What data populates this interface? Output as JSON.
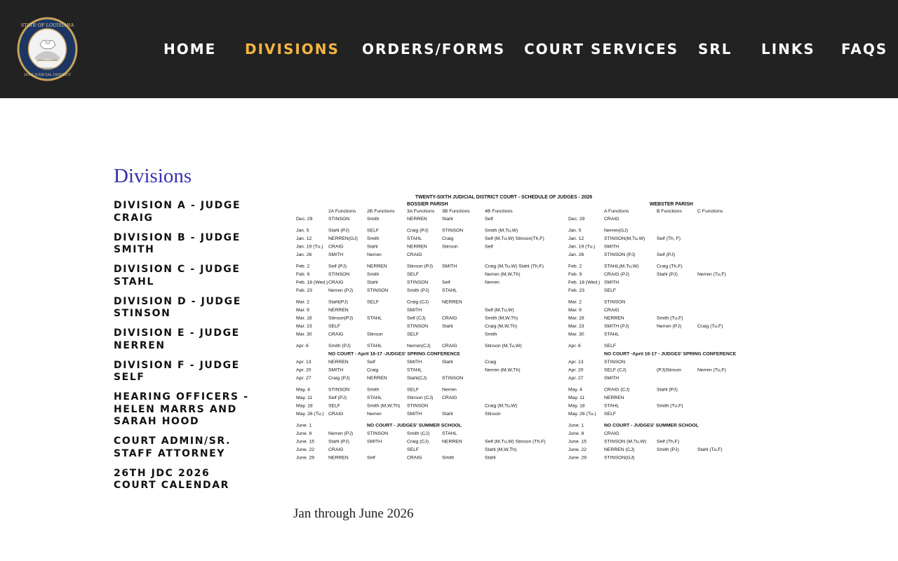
{
  "nav": {
    "items": [
      {
        "label": "HOME"
      },
      {
        "label": "DIVISIONS"
      },
      {
        "label": "ORDERS/FORMS"
      },
      {
        "label": "COURT SERVICES"
      },
      {
        "label": "SRL"
      },
      {
        "label": "LINKS"
      },
      {
        "label": "FAQS"
      }
    ],
    "active_index": 1,
    "active_color": "#f3b543"
  },
  "seal": {
    "icon": "state-seal-icon",
    "text": "STATE OF LOUISIANA · UNION · JUSTICE · CONFIDENCE · 26TH JUDICIAL DISTRICT COURT"
  },
  "sidebar": {
    "title": "Divisions",
    "items": [
      "DIVISION A - JUDGE CRAIG",
      "DIVISION B - JUDGE SMITH",
      "DIVISION C - JUDGE STAHL",
      "DIVISION D - JUDGE STINSON",
      "DIVISION E - JUDGE NERREN",
      "DIVISION F - JUDGE SELF",
      "HEARING OFFICERS - HELEN MARRS AND SARAH HOOD",
      "COURT ADMIN/SR. STAFF ATTORNEY",
      "26TH JDC 2026 COURT CALENDAR"
    ]
  },
  "schedule": {
    "title": "TWENTY-SIXTH JUDICIAL DISTRICT COURT - SCHEDULE OF JUDGES - 2026",
    "bossier_label": "BOSSIER PARISH",
    "webster_label": "WEBSTER PARISH",
    "bossier_headers": [
      "2A Functions",
      "2B Functions",
      "3A Functions",
      "3B Functions",
      "4B Functions"
    ],
    "webster_headers": [
      "A Functions",
      "B Functions",
      "C Functions"
    ],
    "rows": [
      {
        "g": 0,
        "b": [
          "Dec. 29",
          "STINSON",
          "Smith",
          "NERREN",
          "Stahl",
          "Self"
        ],
        "w": [
          "Dec. 29",
          "CRAIG",
          "",
          ""
        ]
      },
      {
        "g": 1,
        "b": [
          "Jan. 5",
          "Stahl (PJ)",
          "SELF",
          "Craig (PJ)",
          "STINSON",
          "Smith (M,Tu,W)"
        ],
        "w": [
          "Jan. 5",
          "Nerren(GJ)",
          "",
          ""
        ]
      },
      {
        "g": 1,
        "b": [
          "Jan. 12",
          "NERREN(GJ)",
          "Smith",
          "STAHL",
          "Craig",
          "Self (M,Tu,W) Stinson(Th,F)"
        ],
        "w": [
          "Jan. 12",
          "STINSON(M,Tu,W)",
          "Self (Th, F)",
          ""
        ]
      },
      {
        "g": 1,
        "b": [
          "Jan. 19 (Tu.)",
          "CRAIG",
          "Stahl",
          "NERREN",
          "Stinson",
          "Self"
        ],
        "w": [
          "Jan. 19 (Tu.)",
          "SMITH",
          "",
          ""
        ]
      },
      {
        "g": 1,
        "b": [
          "Jan. 26",
          "SMITH",
          "Nerren",
          "CRAIG",
          "",
          ""
        ],
        "w": [
          "Jan. 26",
          "STINSON (PJ)",
          "Self (PJ)",
          ""
        ]
      },
      {
        "g": 2,
        "b": [
          "Feb. 2",
          "Self (PJ)",
          "NERREN",
          "Stinson (PJ)",
          "SMITH",
          "Craig (M,Tu,W) Stahl (Th,F)"
        ],
        "w": [
          "Feb. 2",
          "STAHL(M,Tu,W)",
          "Craig (Th,F)",
          ""
        ]
      },
      {
        "g": 2,
        "b": [
          "Feb. 9",
          "STINSON",
          "Smith",
          "SELF",
          "",
          "Nerren (M,W,Th)"
        ],
        "w": [
          "Feb. 9",
          "CRAIG (PJ)",
          "Stahl (PJ)",
          "Nerren (Tu,F)"
        ]
      },
      {
        "g": 2,
        "b": [
          "Feb. 18 (Wed.)",
          "CRAIG",
          "Stahl",
          "STINSON",
          "Self",
          "Nerren"
        ],
        "w": [
          "Feb. 18 (Wed.)",
          "SMITH",
          "",
          ""
        ]
      },
      {
        "g": 2,
        "b": [
          "Feb. 23",
          "Nerren (PJ)",
          "STINSON",
          "Smith (PJ)",
          "STAHL",
          ""
        ],
        "w": [
          "Feb. 23",
          "SELF",
          "",
          ""
        ]
      },
      {
        "g": 3,
        "b": [
          "Mar. 2",
          "Stahl(PJ)",
          "SELF",
          "Craig (CJ)",
          "NERREN",
          ""
        ],
        "w": [
          "Mar. 2",
          "STINSON",
          "",
          ""
        ]
      },
      {
        "g": 3,
        "b": [
          "Mar. 9",
          "NERREN",
          "",
          "SMITH",
          "",
          "Self (M,Tu,W)"
        ],
        "w": [
          "Mar. 9",
          "CRAIG",
          "",
          ""
        ]
      },
      {
        "g": 3,
        "b": [
          "Mar. 16",
          "Stinson(PJ)",
          "STAHL",
          "Self (CJ)",
          "CRAIG",
          "Smith (M,W,Th)"
        ],
        "w": [
          "Mar. 16",
          "NERREN",
          "Smith (Tu,F)",
          ""
        ]
      },
      {
        "g": 3,
        "b": [
          "Mar. 23",
          "SELF",
          "",
          "STINSON",
          "Stahl",
          "Craig (M,W,Th)"
        ],
        "w": [
          "Mar. 23",
          "SMITH (PJ)",
          "Nerren (PJ)",
          "Craig (Tu,F)"
        ]
      },
      {
        "g": 3,
        "b": [
          "Mar. 30",
          "CRAIG",
          "Stinson",
          "SELF",
          "",
          "Smith"
        ],
        "w": [
          "Mar. 30",
          "STAHL",
          "",
          ""
        ]
      },
      {
        "g": 4,
        "b": [
          "Apr. 6",
          "Smith (PJ)",
          "STAHL",
          "Nerren(CJ)",
          "CRAIG",
          "Stinson (M,Tu,W)"
        ],
        "w": [
          "Apr. 6",
          "SELF",
          "",
          ""
        ]
      },
      {
        "g": 4,
        "note_b": "NO COURT -  April 16-17 -JUDGES' SPRING CONFERENCE",
        "note_w": "NO COURT -April 16-17 -  JUDGES' SPRING CONFERENCE"
      },
      {
        "g": 4,
        "b": [
          "Apr. 13",
          "NERREN",
          "Self",
          "SMITH",
          "Stahl",
          "Craig"
        ],
        "w": [
          "Apr. 13",
          "STINSON",
          "",
          ""
        ]
      },
      {
        "g": 4,
        "b": [
          "Apr. 20",
          "SMITH",
          "Craig",
          "STAHL",
          "",
          "Nerren (M,W,Th)"
        ],
        "w": [
          "Apr. 20",
          "SELF (CJ)",
          "(PJ)Stinson",
          "Nerren (Tu,F)"
        ]
      },
      {
        "g": 4,
        "b": [
          "Apr. 27",
          "Craig (PJ)",
          "NERREN",
          "Stahl(CJ)",
          "STINSON",
          ""
        ],
        "w": [
          "Apr. 27",
          "SMITH",
          "",
          ""
        ]
      },
      {
        "g": 5,
        "b": [
          "May. 4",
          "STINSON",
          "Smith",
          "SELF",
          "Nerren",
          ""
        ],
        "w": [
          "May. 4",
          "CRAIG (CJ)",
          "Stahl (PJ)",
          ""
        ]
      },
      {
        "g": 5,
        "b": [
          "May. 11",
          "Self (PJ)",
          "STAHL",
          "Stinson (CJ)",
          "CRAIG",
          ""
        ],
        "w": [
          "May. 11",
          "NERREN",
          "",
          ""
        ]
      },
      {
        "g": 5,
        "b": [
          "May. 18",
          "SELF",
          "Smith (M,W,Th)",
          "STINSON",
          "",
          "Craig (M,Tu,W)"
        ],
        "w": [
          "May. 18",
          "STAHL",
          "Smith (Tu,F)",
          ""
        ]
      },
      {
        "g": 5,
        "b": [
          "May. 26 (Tu.)",
          "CRAIG",
          "Nerren",
          "SMITH",
          "Stahl",
          "Stinson"
        ],
        "w": [
          "May. 26 (Tu.)",
          "SELF",
          "",
          ""
        ]
      },
      {
        "g": 6,
        "b": [
          "June. 1",
          "",
          "NO COURT - JUDGES' SUMMER SCHOOL",
          "",
          "",
          ""
        ],
        "w": [
          "June. 1",
          "NO COURT - JUDGES' SUMMER SCHOOL",
          "",
          ""
        ]
      },
      {
        "g": 6,
        "b": [
          "June. 8",
          "Nerren (PJ)",
          "STINSON",
          "Smith (CJ)",
          "STAHL",
          ""
        ],
        "w": [
          "June. 8",
          "CRAIG",
          "",
          ""
        ]
      },
      {
        "g": 6,
        "b": [
          "June. 15",
          "Stahl (PJ)",
          "SMITH",
          "Craig (CJ)",
          "NERREN",
          "Self (M,Tu,W) Stinson (Th,F)"
        ],
        "w": [
          "June. 15",
          "STINSON (M,Tu,W)",
          "Self (Th,F)",
          ""
        ]
      },
      {
        "g": 6,
        "b": [
          "June. 22",
          "CRAIG",
          "",
          "SELF",
          "",
          "Stahl (M,W,Th)"
        ],
        "w": [
          "June. 22",
          "NERREN (CJ)",
          "Smith (PJ)",
          "Stahl (Tu,F)"
        ]
      },
      {
        "g": 6,
        "b": [
          "June. 29",
          "NERREN",
          "Self",
          "CRAIG",
          "Smith",
          "Stahl"
        ],
        "w": [
          "June. 29",
          "STINSON(GJ)",
          "",
          ""
        ]
      }
    ]
  },
  "caption": "Jan through June 2026"
}
